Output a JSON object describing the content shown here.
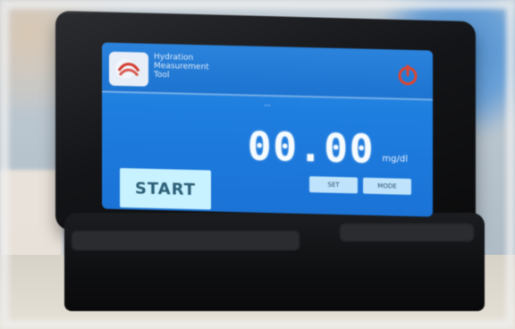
{
  "screen": {
    "header_lines": [
      "Hydration",
      "Measurement",
      "Tool"
    ],
    "small_label": "---",
    "reading": {
      "value": "00.00",
      "unit": "mg/dl"
    },
    "buttons": {
      "start": "START",
      "small_left": "SET",
      "small_right": "MODE"
    }
  },
  "icons": [
    "logo-icon",
    "power-icon"
  ],
  "colors": {
    "screen_blue": "#1e7ee0",
    "power_red": "#e0442f"
  }
}
